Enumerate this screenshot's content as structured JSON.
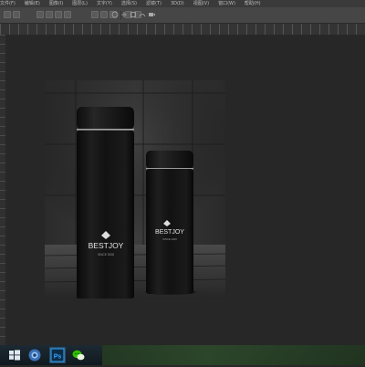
{
  "app": {
    "menu": [
      "文件(F)",
      "编辑(E)",
      "图像(I)",
      "图层(L)",
      "文字(Y)",
      "选择(S)",
      "滤镜(T)",
      "3D(D)",
      "视图(V)",
      "窗口(W)",
      "帮助(H)"
    ]
  },
  "canvas": {
    "product_brand_tall": "BESTJOY",
    "product_tagline_tall": "SINCE 2008",
    "product_brand_short": "BESTJOY",
    "product_tagline_short": "SINCE 2008",
    "product_color": "#141414",
    "wall_color": "#2a2a2a",
    "floor_color": "#3b3b3b"
  },
  "taskbar": {
    "items": [
      "start-button",
      "browser-icon",
      "photoshop-icon",
      "wechat-icon"
    ],
    "ps_label": "Ps",
    "wallpaper_color": "#2e4a2a"
  },
  "colors": {
    "menubar_bg": "#3a3a3a",
    "optionsbar_bg": "#464646",
    "workspace_bg": "#272727"
  }
}
